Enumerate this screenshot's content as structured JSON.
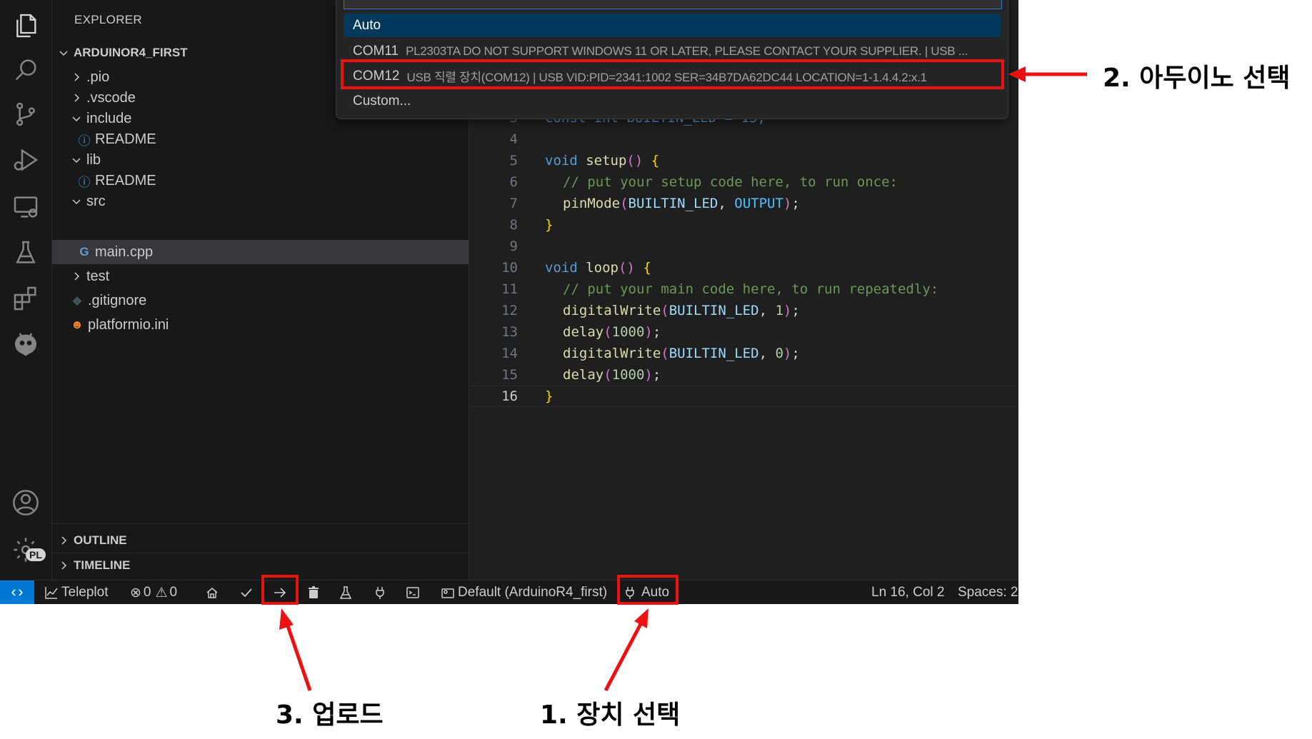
{
  "sidebar": {
    "title": "EXPLORER",
    "project": "ARDUINOR4_FIRST",
    "tree": [
      {
        "label": ".pio"
      },
      {
        "label": ".vscode"
      },
      {
        "label": "include"
      },
      {
        "label": "README"
      },
      {
        "label": "lib"
      },
      {
        "label": "README"
      },
      {
        "label": "src"
      },
      {
        "label": "main.cpp"
      },
      {
        "label": "test"
      },
      {
        "label": ".gitignore"
      },
      {
        "label": "platformio.ini"
      }
    ],
    "outline": "OUTLINE",
    "timeline": "TIMELINE"
  },
  "quickpick": {
    "items": [
      {
        "label": "Auto",
        "desc": ""
      },
      {
        "label": "COM11",
        "desc": "PL2303TA DO NOT SUPPORT WINDOWS 11 OR LATER, PLEASE CONTACT YOUR SUPPLIER. | USB ..."
      },
      {
        "label": "COM12",
        "desc": "USB 직렬 장치(COM12) | USB VID:PID=2341:1002 SER=34B7DA62DC44 LOCATION=1-1.4.4.2:x.1"
      },
      {
        "label": "Custom...",
        "desc": ""
      }
    ]
  },
  "editor": {
    "partial_line": "const int BUILTIN_LED = 13;",
    "lines": [
      {
        "n": "4"
      },
      {
        "n": "5"
      },
      {
        "n": "6"
      },
      {
        "n": "7"
      },
      {
        "n": "8"
      },
      {
        "n": "9"
      },
      {
        "n": "10"
      },
      {
        "n": "11"
      },
      {
        "n": "12"
      },
      {
        "n": "13"
      },
      {
        "n": "14"
      },
      {
        "n": "15"
      },
      {
        "n": "16"
      }
    ],
    "tokens": {
      "void": "void",
      "setup": "setup",
      "loop": "loop",
      "paren_open": "(",
      "paren_close": ")",
      "brace_open": "{",
      "brace_close": "}",
      "comment_setup": "// put your setup code here, to run once:",
      "comment_loop": "// put your main code here, to run repeatedly:",
      "pinMode": "pinMode",
      "digitalWrite": "digitalWrite",
      "delay": "delay",
      "BUILTIN_LED": "BUILTIN_LED",
      "OUTPUT": "OUTPUT",
      "comma": ", ",
      "semi": ";",
      "one": "1",
      "zero": "0",
      "thousand": "1000"
    }
  },
  "statusbar": {
    "teleplot": "Teleplot",
    "errors": "0",
    "warnings": "0",
    "env": "Default (ArduinoR4_first)",
    "port": "Auto",
    "position": "Ln 16, Col 2",
    "spaces": "Spaces: 2"
  },
  "annotations": {
    "select_device": "1. 장치 선택",
    "select_arduino": "2. 아두이노 선택",
    "upload": "3. 업로드"
  },
  "colors": {
    "annotation_red": "#ee1111",
    "status_remote": "#0078d4",
    "selection_blue": "#04395e"
  }
}
